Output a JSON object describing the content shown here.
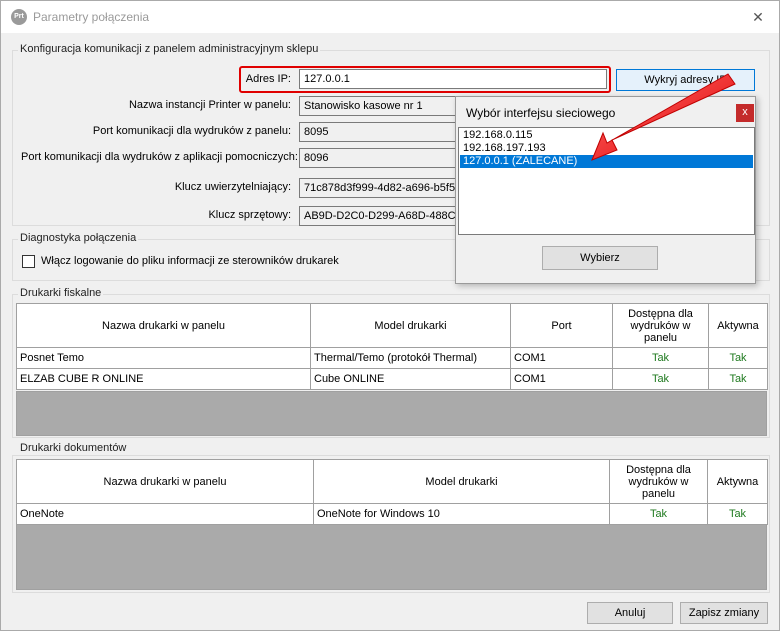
{
  "window": {
    "title": "Parametry połączenia",
    "app_icon_text": "Prt",
    "close_glyph": "✕"
  },
  "communication": {
    "legend": "Konfiguracja komunikacji z panelem administracyjnym sklepu",
    "ip_label": "Adres IP:",
    "ip_value": "127.0.0.1",
    "detect_button": "Wykryj adresy IP",
    "instance_label": "Nazwa instancji Printer w panelu:",
    "instance_value": "Stanowisko kasowe nr 1",
    "port_panel_label": "Port komunikacji dla wydruków z panelu:",
    "port_panel_value": "8095",
    "port_helper_label": "Port komunikacji dla wydruków z aplikacji pomocniczych:",
    "port_helper_value": "8096",
    "auth_key_label": "Klucz uwierzytelniający:",
    "auth_key_value": "71c878d3f999-4d82-a696-b5f5c",
    "hw_key_label": "Klucz sprzętowy:",
    "hw_key_value": "AB9D-D2C0-D299-A68D-488C-0"
  },
  "diagnostics": {
    "legend": "Diagnostyka połączenia",
    "logging_label": "Włącz logowanie do pliku informacji ze sterowników drukarek",
    "logging_checked": false
  },
  "fiscal_printers": {
    "legend": "Drukarki fiskalne",
    "columns": [
      "Nazwa drukarki w panelu",
      "Model drukarki",
      "Port",
      "Dostępna dla wydruków w panelu",
      "Aktywna"
    ],
    "rows": [
      [
        "Posnet Temo",
        "Thermal/Temo (protokół Thermal)",
        "COM1",
        "Tak",
        "Tak"
      ],
      [
        "ELZAB CUBE R ONLINE",
        "Cube ONLINE",
        "COM1",
        "Tak",
        "Tak"
      ]
    ]
  },
  "document_printers": {
    "legend": "Drukarki dokumentów",
    "columns": [
      "Nazwa drukarki w panelu",
      "Model drukarki",
      "Dostępna dla wydruków w panelu",
      "Aktywna"
    ],
    "rows": [
      [
        "OneNote",
        "OneNote for Windows 10",
        "Tak",
        "Tak"
      ]
    ]
  },
  "footer": {
    "cancel_button": "Anuluj",
    "save_button": "Zapisz zmiany"
  },
  "popup": {
    "title": "Wybór interfejsu sieciowego",
    "close_glyph": "x",
    "items": [
      "192.168.0.115",
      "192.168.197.193",
      "127.0.0.1 (ZALECANE)"
    ],
    "selected_index": 2,
    "choose_button": "Wybierz"
  },
  "colors": {
    "highlight": "#e00000",
    "selection": "#0078d7",
    "yes_text": "#1f7a1f",
    "grid_empty": "#aaaaaa"
  }
}
